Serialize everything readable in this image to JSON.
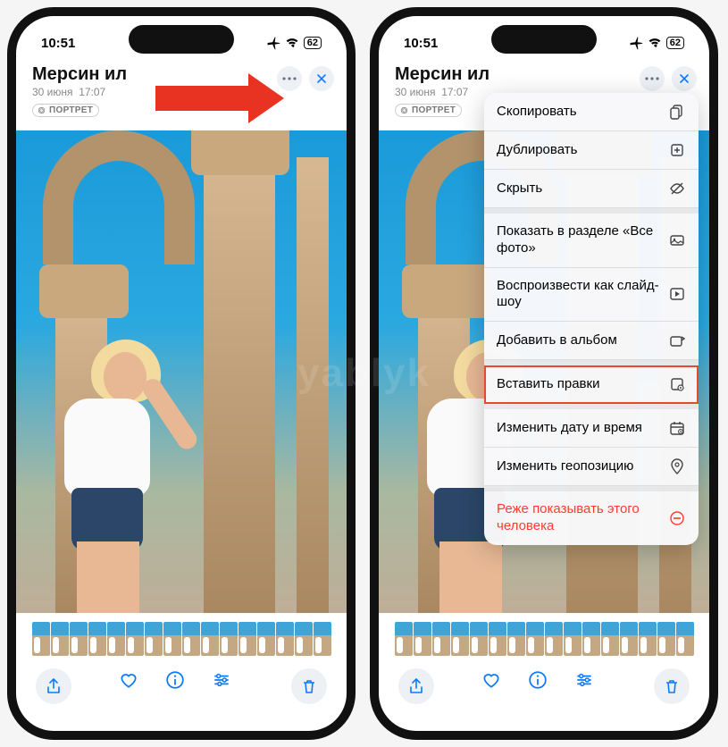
{
  "status": {
    "time": "10:51",
    "battery": "62"
  },
  "header": {
    "title": "Мерсин ил",
    "date": "30 июня",
    "time": "17:07",
    "badge": "ПОРТРЕТ"
  },
  "thumbnails": {
    "count": 16
  },
  "menu": {
    "items": [
      {
        "label": "Скопировать",
        "icon": "copy"
      },
      {
        "label": "Дублировать",
        "icon": "duplicate"
      },
      {
        "label": "Скрыть",
        "icon": "hide"
      },
      {
        "label": "Показать в разделе «Все фото»",
        "icon": "gallery"
      },
      {
        "label": "Воспроизвести как слайд-шоу",
        "icon": "play"
      },
      {
        "label": "Добавить в альбом",
        "icon": "album"
      },
      {
        "label": "Вставить правки",
        "icon": "paste-edit",
        "highlight": true
      },
      {
        "label": "Изменить дату и время",
        "icon": "calendar"
      },
      {
        "label": "Изменить геопозицию",
        "icon": "location"
      },
      {
        "label": "Реже показывать этого человека",
        "icon": "remove",
        "danger": true
      }
    ],
    "separators_after": [
      2,
      5,
      6,
      8
    ]
  },
  "watermark": "yablyk"
}
